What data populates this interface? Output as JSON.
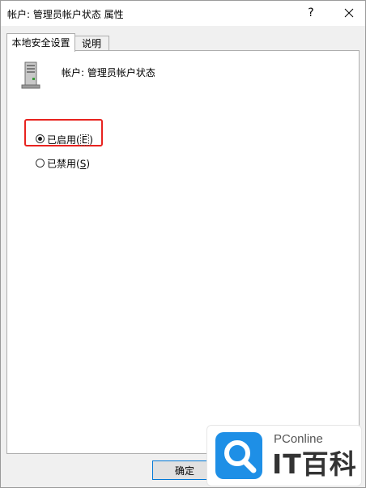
{
  "window": {
    "title": "帐户: 管理员帐户状态 属性",
    "help_glyph": "?"
  },
  "tabs": [
    {
      "label": "本地安全设置",
      "active": true
    },
    {
      "label": "说明",
      "active": false
    }
  ],
  "policy": {
    "icon": "server-icon",
    "label": "帐户: 管理员帐户状态"
  },
  "options": [
    {
      "label": "已启用",
      "accel": "E",
      "checked": true
    },
    {
      "label": "已禁用",
      "accel": "S",
      "checked": false
    }
  ],
  "buttons": {
    "ok_label": "确定"
  },
  "watermark": {
    "brand": "PConline",
    "name": "IT百科"
  },
  "colors": {
    "highlight": "#e8231f",
    "accent": "#0078d7",
    "logo": "#1e8fe6"
  }
}
